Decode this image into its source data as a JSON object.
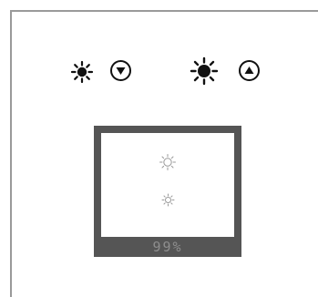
{
  "controls": {
    "brightness_down_icon": "brightness-low-icon",
    "brightness_down_button_icon": "triangle-down-icon",
    "brightness_up_icon": "brightness-high-icon",
    "brightness_up_button_icon": "triangle-up-icon"
  },
  "preview": {
    "high_indicator_icon": "brightness-outline-high-icon",
    "low_indicator_icon": "brightness-outline-low-icon",
    "level_text": "99%",
    "level_value": 99
  },
  "colors": {
    "panel": "#555555",
    "level_text": "#8e8e8e",
    "frame_border": "#9a9a9a",
    "icon": "#111111"
  }
}
